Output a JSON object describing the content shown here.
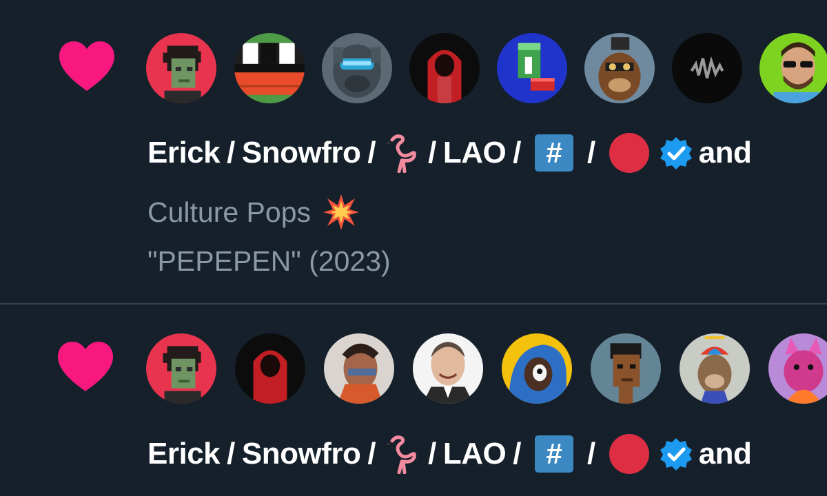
{
  "colors": {
    "background": "#15202b",
    "divider": "#38444d",
    "heart": "#f91880",
    "name_text": "#ffffff",
    "secondary_text": "#8b98a5",
    "verified_badge": "#1d9bf0",
    "hash_keycap": "#3b88c3",
    "red_circle": "#dd2e44"
  },
  "notifications": [
    {
      "type_icon": "heart-icon",
      "avatars": [
        "zombie-punk-avatar",
        "flag-stripes-avatar",
        "robot-mask-avatar",
        "red-hoodie-avatar",
        "green-blocks-avatar",
        "ape-helmet-avatar",
        "waveform-avatar",
        "man-sunglasses-avatar"
      ],
      "names": {
        "erick": "Erick",
        "sep": "/",
        "snowfro": "Snowfro",
        "lao": "LAO",
        "and": "and"
      },
      "tweet": {
        "line1": "Culture Pops",
        "line2": "\"PEPEPEN\" (2023)"
      }
    },
    {
      "type_icon": "heart-icon",
      "avatars": [
        "zombie-punk-avatar",
        "red-hoodie-avatar",
        "painted-portrait-avatar",
        "bald-man-avatar",
        "parrot-avatar",
        "pixel-punk-avatar",
        "propeller-ape-avatar",
        "pink-cat-avatar"
      ],
      "names": {
        "erick": "Erick",
        "sep": "/",
        "snowfro": "Snowfro",
        "lao": "LAO",
        "and": "and"
      }
    }
  ]
}
